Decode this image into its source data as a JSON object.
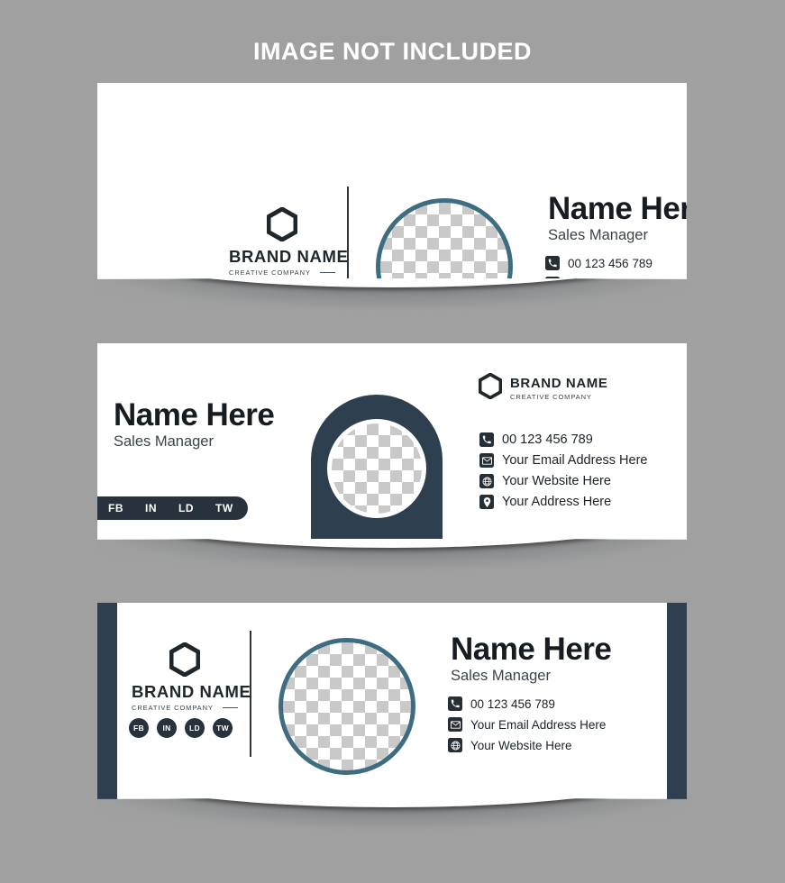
{
  "heading": "IMAGE NOT INCLUDED",
  "brand": {
    "name": "BRAND NAME",
    "tagline": "CREATIVE COMPANY",
    "logo_icon": "hexagon-outline-icon"
  },
  "person": {
    "name": "Name Here",
    "title": "Sales Manager"
  },
  "colors": {
    "background": "#a0a0a0",
    "card": "#ffffff",
    "navy": "#2e3f4f",
    "dark": "#27323c",
    "teal_ring": "#3e6c80",
    "text": "#161c21",
    "checker": "#c9c9c9"
  },
  "contacts": {
    "phone": {
      "icon": "phone-icon",
      "text": "00 123 456 789"
    },
    "email": {
      "icon": "envelope-icon",
      "text": "Your Email Address Here"
    },
    "website": {
      "icon": "globe-icon",
      "text": "Your Website Here"
    },
    "address": {
      "icon": "location-pin-icon",
      "text": "Your Address Here"
    }
  },
  "social": {
    "items": [
      {
        "label": "FB",
        "name": "facebook"
      },
      {
        "label": "IN",
        "name": "instagram"
      },
      {
        "label": "LD",
        "name": "linkedin"
      },
      {
        "label": "TW",
        "name": "twitter"
      }
    ]
  },
  "cards": [
    {
      "id": "card-1",
      "layout": "logo-left-photo-center-info-right",
      "contact_count": 3
    },
    {
      "id": "card-2",
      "layout": "name-left-arch-center-brand-right",
      "contact_count": 4,
      "social_bar": true
    },
    {
      "id": "card-3",
      "layout": "sidebars-logo-left-photo-center-info-right",
      "contact_count": 3,
      "social_badges": true
    }
  ]
}
